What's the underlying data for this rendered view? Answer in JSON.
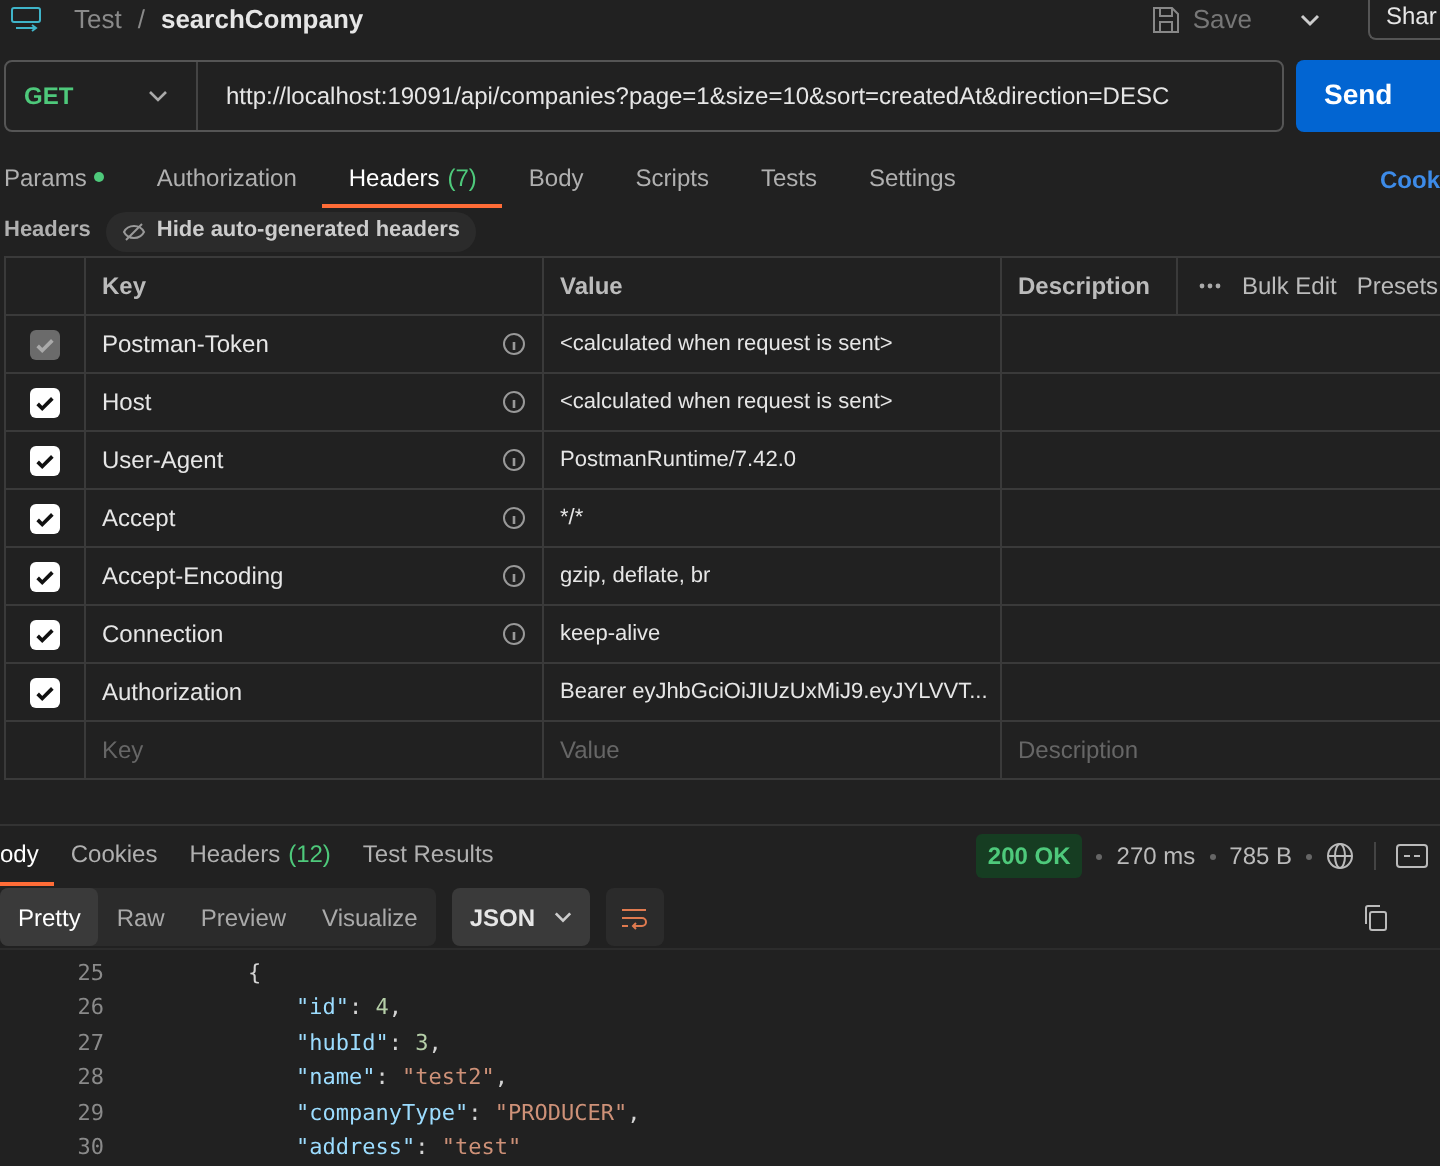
{
  "breadcrumb": {
    "collection": "Test",
    "separator": "/",
    "request": "searchCompany"
  },
  "save": {
    "label": "Save",
    "disabled": true
  },
  "share": {
    "label": "Shar"
  },
  "request": {
    "method": "GET",
    "url": "http://localhost:19091/api/companies?page=1&size=10&sort=createdAt&direction=DESC",
    "send": "Send"
  },
  "tabs": [
    {
      "label": "Params",
      "dot": true,
      "selected": false
    },
    {
      "label": "Authorization",
      "selected": false
    },
    {
      "label": "Headers",
      "count": "(7)",
      "selected": true
    },
    {
      "label": "Body",
      "selected": false
    },
    {
      "label": "Scripts",
      "selected": false
    },
    {
      "label": "Tests",
      "selected": false
    },
    {
      "label": "Settings",
      "selected": false
    }
  ],
  "cookies_link": "Cook",
  "headers_section": {
    "title": "Headers",
    "hide_button": "Hide auto-generated headers"
  },
  "table": {
    "columns": [
      "Key",
      "Value",
      "Description"
    ],
    "bulk_edit": "Bulk Edit",
    "presets": "Presets",
    "rows": [
      {
        "key": "Postman-Token",
        "value": "<calculated when request is sent>",
        "checked": true,
        "disabled": true,
        "info": true
      },
      {
        "key": "Host",
        "value": "<calculated when request is sent>",
        "checked": true,
        "disabled": false,
        "info": true
      },
      {
        "key": "User-Agent",
        "value": "PostmanRuntime/7.42.0",
        "checked": true,
        "disabled": false,
        "info": true
      },
      {
        "key": "Accept",
        "value": "*/*",
        "checked": true,
        "disabled": false,
        "info": true
      },
      {
        "key": "Accept-Encoding",
        "value": "gzip, deflate, br",
        "checked": true,
        "disabled": false,
        "info": true
      },
      {
        "key": "Connection",
        "value": "keep-alive",
        "checked": true,
        "disabled": false,
        "info": true
      },
      {
        "key": "Authorization",
        "value": "Bearer eyJhbGciOiJIUzUxMiJ9.eyJYLVVT...",
        "checked": true,
        "disabled": false,
        "info": false
      }
    ],
    "new_row": {
      "key_placeholder": "Key",
      "value_placeholder": "Value",
      "description_placeholder": "Description"
    }
  },
  "response": {
    "tabs": [
      {
        "label": "ody",
        "selected": true
      },
      {
        "label": "Cookies",
        "selected": false
      },
      {
        "label": "Headers",
        "count": "(12)",
        "selected": false
      },
      {
        "label": "Test Results",
        "selected": false
      }
    ],
    "status": "200 OK",
    "time": "270 ms",
    "size": "785 B",
    "formats": [
      {
        "label": "Pretty",
        "selected": true
      },
      {
        "label": "Raw",
        "selected": false
      },
      {
        "label": "Preview",
        "selected": false
      },
      {
        "label": "Visualize",
        "selected": false
      }
    ],
    "language": "JSON",
    "code": [
      {
        "number": "25",
        "tokens": [
          {
            "kind": "punct",
            "text": "{"
          }
        ],
        "children": [
          {
            "number": "26",
            "tokens": [
              {
                "kind": "key",
                "text": "\"id\""
              },
              {
                "kind": "punct",
                "text": ": "
              },
              {
                "kind": "number",
                "text": "4"
              },
              {
                "kind": "punct",
                "text": ","
              }
            ]
          },
          {
            "number": "27",
            "tokens": [
              {
                "kind": "key",
                "text": "\"hubId\""
              },
              {
                "kind": "punct",
                "text": ": "
              },
              {
                "kind": "number",
                "text": "3"
              },
              {
                "kind": "punct",
                "text": ","
              }
            ]
          },
          {
            "number": "28",
            "tokens": [
              {
                "kind": "key",
                "text": "\"name\""
              },
              {
                "kind": "punct",
                "text": ": "
              },
              {
                "kind": "string",
                "text": "\"test2\""
              },
              {
                "kind": "punct",
                "text": ","
              }
            ]
          },
          {
            "number": "29",
            "tokens": [
              {
                "kind": "key",
                "text": "\"companyType\""
              },
              {
                "kind": "punct",
                "text": ": "
              },
              {
                "kind": "string",
                "text": "\"PRODUCER\""
              },
              {
                "kind": "punct",
                "text": ","
              }
            ]
          },
          {
            "number": "30",
            "tokens": [
              {
                "kind": "key",
                "text": "\"address\""
              },
              {
                "kind": "punct",
                "text": ": "
              },
              {
                "kind": "string",
                "text": "\"test\""
              }
            ]
          }
        ]
      }
    ]
  }
}
